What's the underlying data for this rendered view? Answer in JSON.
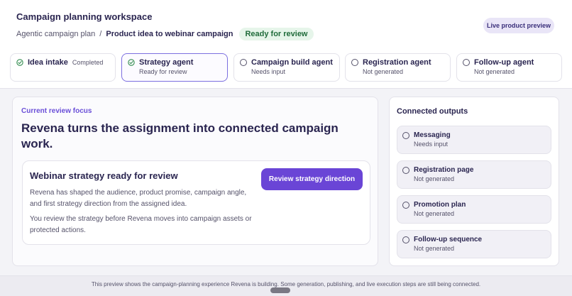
{
  "header": {
    "title": "Campaign planning workspace",
    "breadcrumb": {
      "parent": "Agentic campaign plan",
      "separator": "/",
      "current": "Product idea to webinar campaign"
    },
    "status_badge": "Ready for review",
    "live_preview_label": "Live product preview"
  },
  "steps": [
    {
      "name": "Idea intake",
      "status": "Completed",
      "icon": "check-circle-icon"
    },
    {
      "name": "Strategy agent",
      "status": "Ready for review",
      "icon": "check-circle-icon"
    },
    {
      "name": "Campaign build agent",
      "status": "Needs input",
      "icon": "empty-circle-icon"
    },
    {
      "name": "Registration agent",
      "status": "Not generated",
      "icon": "empty-circle-icon"
    },
    {
      "name": "Follow-up agent",
      "status": "Not generated",
      "icon": "empty-circle-icon"
    }
  ],
  "focus": {
    "label": "Current review focus",
    "headline": "Revena turns the assignment into connected campaign work.",
    "card": {
      "title": "Webinar strategy ready for review",
      "p1": "Revena has shaped the audience, product promise, campaign angle, and first strategy direction from the assigned idea.",
      "p2": "You review the strategy before Revena moves into campaign assets or protected actions.",
      "button": "Review strategy direction"
    }
  },
  "outputs": {
    "title": "Connected outputs",
    "items": [
      {
        "name": "Messaging",
        "status": "Needs input"
      },
      {
        "name": "Registration page",
        "status": "Not generated"
      },
      {
        "name": "Promotion plan",
        "status": "Not generated"
      },
      {
        "name": "Follow-up sequence",
        "status": "Not generated"
      }
    ]
  },
  "footer": "This preview shows the campaign-planning experience Revena is building. Some generation, publishing, and live execution steps are still being connected.",
  "colors": {
    "accent": "#6a45d6",
    "ready_bg": "#e6f5ea",
    "ready_text": "#1f6b3a",
    "check": "#2f8a4c"
  }
}
